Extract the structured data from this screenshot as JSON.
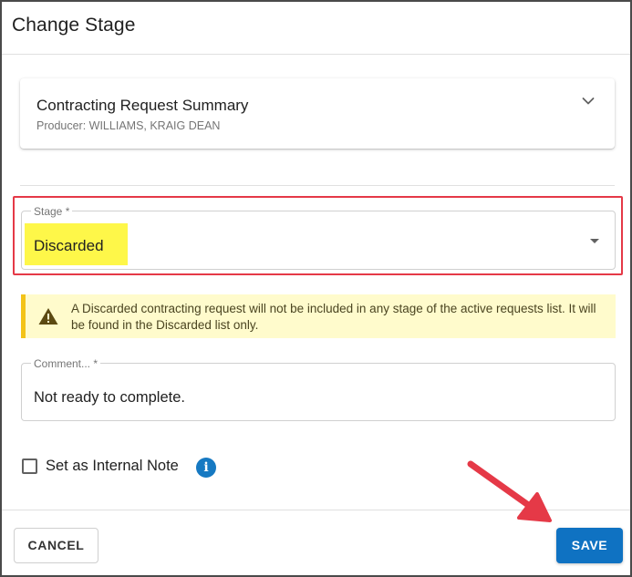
{
  "dialog": {
    "title": "Change Stage"
  },
  "summary": {
    "title": "Contracting Request Summary",
    "subtitle": "Producer: WILLIAMS, KRAIG DEAN",
    "toggle_icon": "chevron-down-icon"
  },
  "stage": {
    "label": "Stage *",
    "value": "Discarded",
    "dropdown_icon": "dropdown-arrow-icon"
  },
  "warning": {
    "icon": "warning-icon",
    "text": "A Discarded contracting request will not be included in any stage of the active requests list. It will be found in the Discarded list only.",
    "background": "#fffbcc",
    "accent": "#f3c319"
  },
  "comment": {
    "label": "Comment... *",
    "value": "Not ready to complete."
  },
  "internal_note": {
    "label": "Set as Internal Note",
    "checked": false,
    "info_icon": "info-icon",
    "info_glyph": "i"
  },
  "footer": {
    "cancel_label": "CANCEL",
    "save_label": "SAVE"
  },
  "colors": {
    "primary": "#0f72c2",
    "annotation_red": "#e53947",
    "highlight_yellow": "#fef749"
  }
}
